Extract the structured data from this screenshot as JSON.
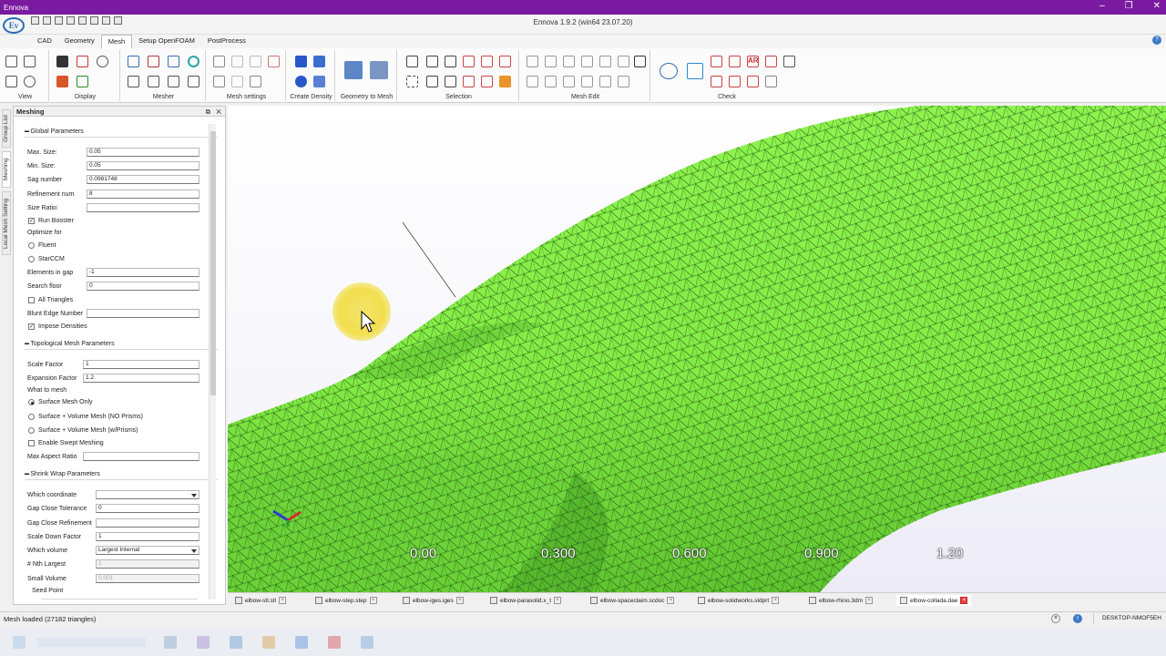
{
  "window": {
    "title": "Ennova",
    "app_title": "Ennova 1.9.2 (win64 23.07.20)"
  },
  "menu": {
    "tabs": [
      "CAD",
      "Geometry",
      "Mesh",
      "Setup OpenFOAM",
      "PostProcess"
    ],
    "active": "Mesh"
  },
  "ribbon": {
    "groups": [
      "View",
      "Display",
      "Mesher",
      "Mesh settings",
      "Create Density",
      "Geometry to Mesh",
      "Selection",
      "Mesh Edit",
      "Check"
    ]
  },
  "panel": {
    "title": "Meshing",
    "side_tabs": [
      "Group List",
      "Meshing",
      "Local Mesh Setting"
    ],
    "global": {
      "header": "Global Parameters",
      "max_size_label": "Max. Size:",
      "max_size": "0.05",
      "min_size_label": "Min. Size:",
      "min_size": "0.05",
      "sag_label": "Sag number",
      "sag": "0.0981748",
      "refinement_label": "Refinement num",
      "refinement": "8",
      "size_ratio_label": "Size Ratio:",
      "size_ratio": "",
      "run_booster": "Run Booster",
      "optimize_label": "Optimize for",
      "fluent": "Fluent",
      "starccm": "StarCCM",
      "elements_gap_label": "Elements in gap",
      "elements_gap": "-1",
      "search_floor_label": "Search floor",
      "search_floor": "0",
      "all_triangles": "All Triangles",
      "blunt_label": "Blunt Edge Number",
      "blunt": "",
      "impose_densities": "Impose Densities"
    },
    "topo": {
      "header": "Topological Mesh Parameters",
      "scale_label": "Scale Factor",
      "scale": "1",
      "expansion_label": "Expansion Factor",
      "expansion": "1.2",
      "what_label": "What to mesh",
      "opt1": "Surface Mesh Only",
      "opt2": "Surface + Volume Mesh (NO Prisms)",
      "opt3": "Surface + Volume Mesh (w/Prisms)",
      "swept": "Enable Swept Meshing",
      "aspect_label": "Max Aspect Ratio",
      "aspect": ""
    },
    "shrink": {
      "header": "Shrink Wrap Parameters",
      "coord_label": "Which coordinate",
      "coord": "",
      "gap_tol_label": "Gap Close Tolerance",
      "gap_tol": "0",
      "gap_ref_label": "Gap Close Refinement",
      "gap_ref": "",
      "scale_down_label": "Scale Down Factor",
      "scale_down": "1",
      "volume_label": "Which volume",
      "volume": "Largest Internal",
      "nth_label": "# Nth Largest",
      "nth": "1",
      "small_label": "Small Volume",
      "small": "0.001",
      "seed_label": "Seed Point"
    }
  },
  "viewport": {
    "scale_labels": [
      "0.00",
      "0.300",
      "0.600",
      "0.900",
      "1.20"
    ],
    "mesh_color": "#84ec45"
  },
  "file_tabs": [
    "elbow-stl.stl",
    "elbow-step.step",
    "elbow-iges.iges",
    "elbow-parasolid.x_t",
    "elbow-spaceclaim.scdoc",
    "elbow-solidworks.sldprt",
    "elbow-rhino.3dm",
    "elbow-collada.dae"
  ],
  "status": {
    "message": "Mesh loaded (27182 triangles)",
    "host": "DESKTOP-NMOF5EH"
  }
}
